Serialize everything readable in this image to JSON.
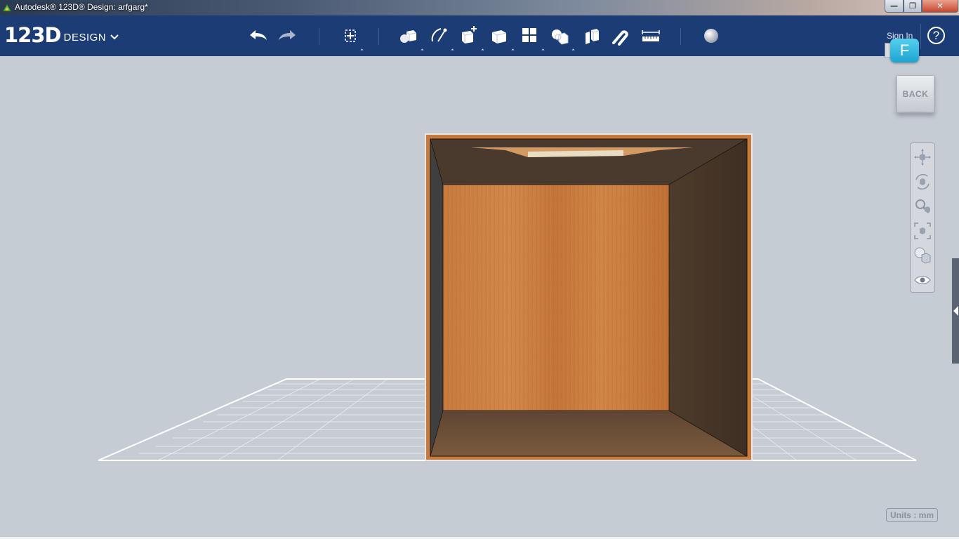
{
  "window": {
    "title": "Autodesk® 123D® Design: arfgarg*",
    "minimize_glyph": "—",
    "maximize_glyph": "❐",
    "close_glyph": "✕"
  },
  "app": {
    "logo_number": "123D",
    "logo_word": "DESIGN"
  },
  "toolbar": {
    "tools": [
      {
        "name": "undo-icon"
      },
      {
        "name": "redo-icon"
      },
      {
        "name": "transform-icon"
      },
      {
        "name": "primitives-icon"
      },
      {
        "name": "sketch-icon"
      },
      {
        "name": "construct-icon"
      },
      {
        "name": "modify-icon"
      },
      {
        "name": "pattern-icon"
      },
      {
        "name": "grouping-icon"
      },
      {
        "name": "combine-icon"
      },
      {
        "name": "snap-icon"
      },
      {
        "name": "measure-icon"
      },
      {
        "name": "material-icon"
      }
    ],
    "sign_in": "Sign In",
    "help": "?",
    "user_initial": "F"
  },
  "viewcube": {
    "face_label": "BACK"
  },
  "navbar": {
    "tools": [
      "pan-icon",
      "orbit-icon",
      "zoom-icon",
      "fit-icon",
      "view-mode-icon",
      "visibility-icon"
    ]
  },
  "status": {
    "units": "Units : mm"
  },
  "colors": {
    "toolbar_bg": "#1b3c74",
    "viewport_bg": "#c6ccd4",
    "wood_front": "#c47438",
    "inner_dark": "#4a3a2e",
    "user_badge": "#2fb6e0"
  }
}
